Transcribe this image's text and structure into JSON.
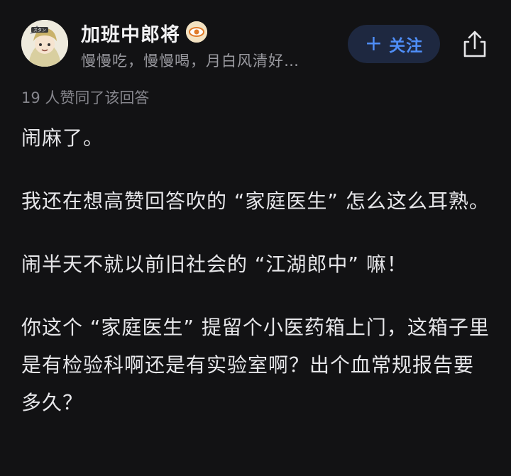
{
  "author": {
    "name": "加班中郎将",
    "bio": "慢慢吃，慢慢喝，月白风清好…",
    "avatar_icon": "anime-avatar",
    "badge_icon": "eye-badge-icon"
  },
  "follow_button": {
    "label": "关注",
    "icon": "plus-icon",
    "color": "#4f8ef7"
  },
  "share_icon": "share-icon",
  "likes_text": "19 人赞同了该回答",
  "paragraphs": [
    "闹麻了。",
    "我还在想高赞回答吹的 “家庭医生” 怎么这么耳熟。",
    "闹半天不就以前旧社会的 “江湖郎中” 嘛！",
    "你这个 “家庭医生” 提留个小医药箱上门，这箱子里是有检验科啊还是有实验室啊？出个血常规报告要多久？"
  ]
}
